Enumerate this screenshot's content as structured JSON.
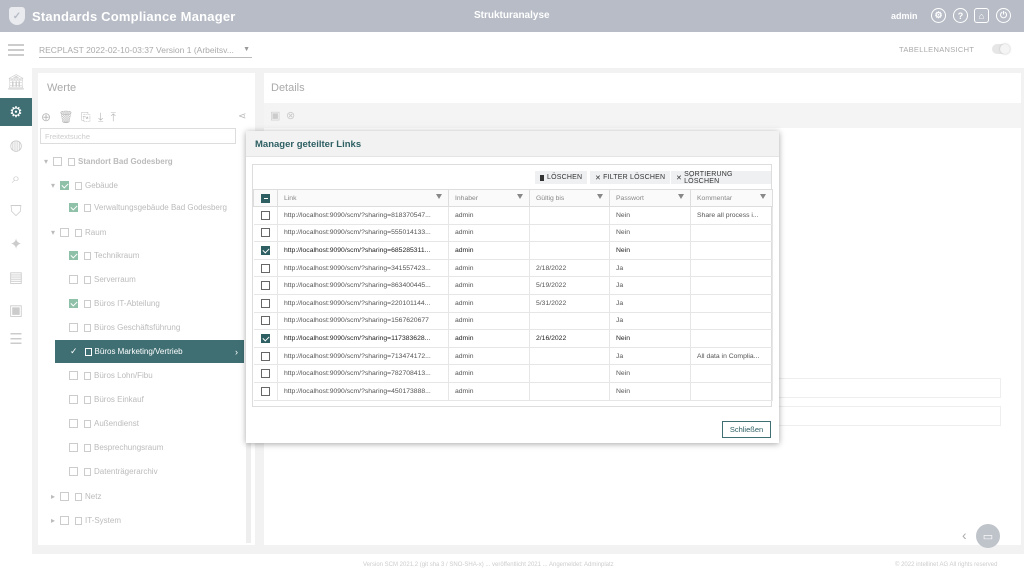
{
  "app": {
    "title": "Standards Compliance Manager",
    "page_title": "Strukturanalyse",
    "user": "admin"
  },
  "toolbar": {
    "version_select": "RECPLAST 2022-02-10-03:37 Version 1 (Arbeitsv...",
    "table_view": "TABELLENANSICHT"
  },
  "left_panel": {
    "title": "Werte",
    "search_placeholder": "Freitextsuche",
    "tree": [
      {
        "label": "Standort Bad Godesberg",
        "checked": false
      },
      {
        "label": "Gebäude",
        "checked": true
      },
      {
        "label": "Verwaltungsgebäude Bad Godesberg",
        "checked": true
      },
      {
        "label": "Raum",
        "checked": false
      },
      {
        "label": "Technikraum",
        "checked": true
      },
      {
        "label": "Serverraum",
        "checked": false
      },
      {
        "label": "Büros IT-Abteilung",
        "checked": true
      },
      {
        "label": "Büros Geschäftsführung",
        "checked": false
      },
      {
        "label": "Büros Marketing/Vertrieb",
        "checked": true
      },
      {
        "label": "Büros Lohn/Fibu",
        "checked": false
      },
      {
        "label": "Büros Einkauf",
        "checked": false
      },
      {
        "label": "Außendienst",
        "checked": false
      },
      {
        "label": "Besprechungsraum",
        "checked": false
      },
      {
        "label": "Datenträgerarchiv",
        "checked": false
      },
      {
        "label": "Netz",
        "checked": false
      },
      {
        "label": "IT-System",
        "checked": false
      }
    ]
  },
  "right_panel": {
    "title": "Details"
  },
  "dialog": {
    "title": "Manager geteilter Links",
    "buttons": {
      "delete": "LÖSCHEN",
      "clear_filter": "FILTER LÖSCHEN",
      "clear_sort": "SORTIERUNG LÖSCHEN"
    },
    "columns": [
      "Link",
      "Inhaber",
      "Gültig bis",
      "Passwort",
      "Kommentar"
    ],
    "rows": [
      {
        "checked": false,
        "link": "http://localhost:9090/scm/?sharing=818370547...",
        "owner": "admin",
        "valid": "",
        "password": "Nein",
        "comment": "Share all process i..."
      },
      {
        "checked": false,
        "link": "http://localhost:9090/scm/?sharing=555014133...",
        "owner": "admin",
        "valid": "",
        "password": "Nein",
        "comment": ""
      },
      {
        "checked": true,
        "link": "http://localhost:9090/scm/?sharing=685285311...",
        "owner": "admin",
        "valid": "",
        "password": "Nein",
        "comment": ""
      },
      {
        "checked": false,
        "link": "http://localhost:9090/scm/?sharing=341557423...",
        "owner": "admin",
        "valid": "2/18/2022",
        "password": "Ja",
        "comment": ""
      },
      {
        "checked": false,
        "link": "http://localhost:9090/scm/?sharing=863400445...",
        "owner": "admin",
        "valid": "5/19/2022",
        "password": "Ja",
        "comment": ""
      },
      {
        "checked": false,
        "link": "http://localhost:9090/scm/?sharing=220101144...",
        "owner": "admin",
        "valid": "5/31/2022",
        "password": "Ja",
        "comment": ""
      },
      {
        "checked": false,
        "link": "http://localhost:9090/scm/?sharing=1567620677",
        "owner": "admin",
        "valid": "",
        "password": "Ja",
        "comment": ""
      },
      {
        "checked": true,
        "link": "http://localhost:9090/scm/?sharing=117383628...",
        "owner": "admin",
        "valid": "2/16/2022",
        "password": "Nein",
        "comment": ""
      },
      {
        "checked": false,
        "link": "http://localhost:9090/scm/?sharing=713474172...",
        "owner": "admin",
        "valid": "",
        "password": "Ja",
        "comment": "All data in Complia..."
      },
      {
        "checked": false,
        "link": "http://localhost:9090/scm/?sharing=782708413...",
        "owner": "admin",
        "valid": "",
        "password": "Nein",
        "comment": ""
      },
      {
        "checked": false,
        "link": "http://localhost:9090/scm/?sharing=450173888...",
        "owner": "admin",
        "valid": "",
        "password": "Nein",
        "comment": ""
      }
    ],
    "close_label": "Schließen"
  },
  "footer": {
    "version": "Version SCM 2021.2 (git sha 3 / SNO-SHA-x) ... veröffentlicht 2021 ... Angemeldet: Adminplatz",
    "copyright": "© 2022 intellinet AG All rights reserved"
  },
  "colors": {
    "primary": "#3f6f73",
    "topbar": "#b7bcc6",
    "accent_text": "#2d5f63"
  }
}
